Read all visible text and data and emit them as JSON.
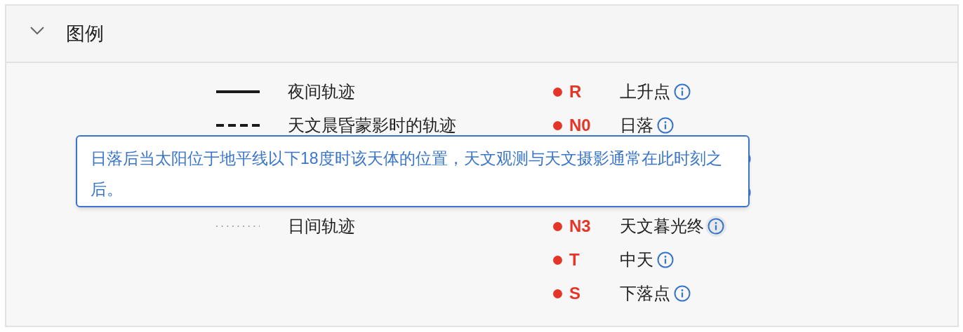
{
  "panel": {
    "title": "图例",
    "expanded": true
  },
  "track_legend": [
    {
      "kind": "solid",
      "label": "夜间轨迹"
    },
    {
      "kind": "dashed",
      "label": "天文晨昏蒙影时的轨迹"
    },
    {
      "kind": "covered"
    },
    {
      "kind": "covered"
    },
    {
      "kind": "dotted",
      "label": "日间轨迹"
    }
  ],
  "point_legend": [
    {
      "kind": "point",
      "code": "R",
      "label": "上升点",
      "hovered": false
    },
    {
      "kind": "point",
      "code": "N0",
      "label": "日落",
      "hovered": false
    },
    {
      "kind": "covered"
    },
    {
      "kind": "covered"
    },
    {
      "kind": "point",
      "code": "N3",
      "label": "天文暮光终",
      "hovered": true
    },
    {
      "kind": "point",
      "code": "T",
      "label": "中天",
      "hovered": false
    },
    {
      "kind": "point",
      "code": "S",
      "label": "下落点",
      "hovered": false
    }
  ],
  "tooltip": {
    "text": "日落后当太阳位于地平线以下18度时该天体的位置，天文观测与天文摄影通常在此时刻之后。"
  }
}
